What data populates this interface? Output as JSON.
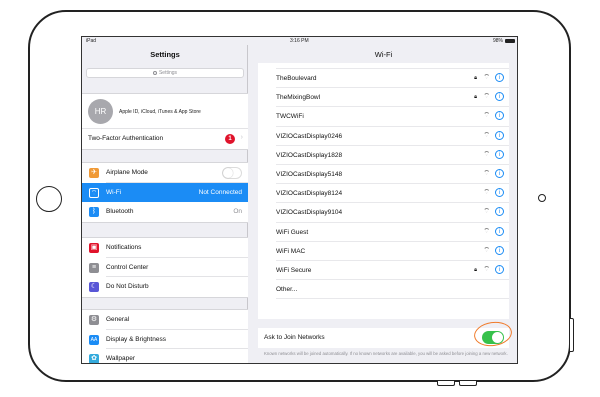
{
  "status_bar": {
    "left": "iPad",
    "time": "3:16 PM",
    "battery": "98%"
  },
  "settings": {
    "title": "Settings",
    "search_placeholder": "Settings",
    "account": {
      "initials": "HR",
      "subtitle": "Apple ID, iCloud, iTunes & App Store"
    },
    "two_factor": {
      "label": "Two-Factor Authentication",
      "badge": "1"
    },
    "items": [
      {
        "label": "Airplane Mode",
        "value": "",
        "icon": "airplane-icon",
        "color": "#f09a37"
      },
      {
        "label": "Wi-Fi",
        "value": "Not Connected",
        "icon": "wifi-icon",
        "color": "#1b8cf5"
      },
      {
        "label": "Bluetooth",
        "value": "On",
        "icon": "bluetooth-icon",
        "color": "#1b8cf5"
      },
      {
        "label": "Notifications",
        "value": "",
        "icon": "notifications-icon",
        "color": "#e0132b"
      },
      {
        "label": "Control Center",
        "value": "",
        "icon": "control-center-icon",
        "color": "#8e8e93"
      },
      {
        "label": "Do Not Disturb",
        "value": "",
        "icon": "moon-icon",
        "color": "#5856d6"
      },
      {
        "label": "General",
        "value": "",
        "icon": "gear-icon",
        "color": "#8e8e93"
      },
      {
        "label": "Display & Brightness",
        "value": "",
        "icon": "display-icon",
        "color": "#1b8cf5"
      },
      {
        "label": "Wallpaper",
        "value": "",
        "icon": "wallpaper-icon",
        "color": "#34aadc"
      }
    ]
  },
  "wifi": {
    "title": "Wi-Fi",
    "networks": [
      {
        "name": "TheBoulevard",
        "locked": true
      },
      {
        "name": "TheMixingBowl",
        "locked": true
      },
      {
        "name": "TWCWiFi",
        "locked": false
      },
      {
        "name": "VIZIOCastDisplay0246",
        "locked": false
      },
      {
        "name": "VIZIOCastDisplay1828",
        "locked": false
      },
      {
        "name": "VIZIOCastDisplay5148",
        "locked": false
      },
      {
        "name": "VIZIOCastDisplay8124",
        "locked": false
      },
      {
        "name": "VIZIOCastDisplay9104",
        "locked": false
      },
      {
        "name": "WiFi Guest",
        "locked": false
      },
      {
        "name": "WiFi MAC",
        "locked": false
      },
      {
        "name": "WiFi Secure",
        "locked": true
      }
    ],
    "other_label": "Other...",
    "ask_to_join": {
      "label": "Ask to Join Networks",
      "enabled": true,
      "footnote": "Known networks will be joined automatically. If no known networks are available, you will be asked before joining a new network."
    }
  },
  "colors": {
    "accent": "#1b8cf5",
    "toggle_on": "#37c14b",
    "annotation": "#f07b2b",
    "badge": "#e0132b"
  }
}
